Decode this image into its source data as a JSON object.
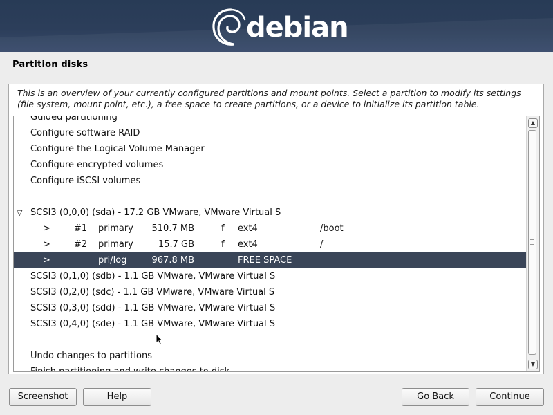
{
  "banner": {
    "logo_text": "debian"
  },
  "page_title": "Partition disks",
  "help_text": "This is an overview of your currently configured partitions and mount points. Select a partition to modify its settings (file system, mount point, etc.), a free space to create partitions, or a device to initialize its partition table.",
  "list": {
    "items": [
      {
        "label": "Guided partitioning"
      },
      {
        "label": "Configure software RAID"
      },
      {
        "label": "Configure the Logical Volume Manager"
      },
      {
        "label": "Configure encrypted volumes"
      },
      {
        "label": "Configure iSCSI volumes"
      },
      {
        "label": ""
      },
      {
        "label": "SCSI3 (0,0,0) (sda) - 17.2 GB VMware, VMware Virtual S",
        "expanded_icon": "▽"
      },
      {
        "arrow": ">",
        "num": "#1",
        "type": "primary",
        "size": "510.7 MB",
        "flag": "f",
        "fs": "ext4",
        "mount": "/boot"
      },
      {
        "arrow": ">",
        "num": "#2",
        "type": "primary",
        "size": "15.7 GB",
        "flag": "f",
        "fs": "ext4",
        "mount": "/"
      },
      {
        "arrow": ">",
        "num": "",
        "type": "pri/log",
        "size": "967.8 MB",
        "flag": "",
        "fs": "FREE SPACE",
        "mount": "",
        "selected": true
      },
      {
        "label": "SCSI3 (0,1,0) (sdb) - 1.1 GB VMware, VMware Virtual S"
      },
      {
        "label": "SCSI3 (0,2,0) (sdc) - 1.1 GB VMware, VMware Virtual S"
      },
      {
        "label": "SCSI3 (0,3,0) (sdd) - 1.1 GB VMware, VMware Virtual S"
      },
      {
        "label": "SCSI3 (0,4,0) (sde) - 1.1 GB VMware, VMware Virtual S"
      },
      {
        "label": ""
      },
      {
        "label": "Undo changes to partitions"
      },
      {
        "label": "Finish partitioning and write changes to disk"
      }
    ]
  },
  "scrollbar": {
    "up_icon": "▲",
    "down_icon": "▼"
  },
  "buttons": {
    "screenshot": "Screenshot",
    "help": "Help",
    "go_back": "Go Back",
    "continue": "Continue"
  },
  "colors": {
    "banner": "#2c3e5a",
    "selection": "#3a4558",
    "background": "#ededed"
  }
}
